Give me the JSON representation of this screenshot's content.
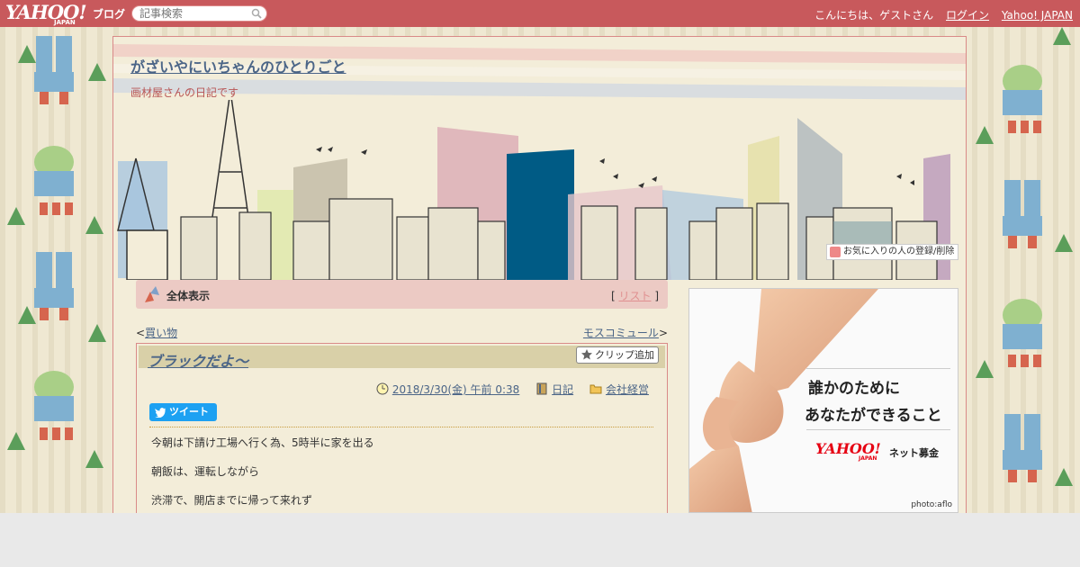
{
  "topbar": {
    "logo_text": "YAHOO!",
    "logo_sub": "JAPAN",
    "service": "ブログ",
    "search_placeholder": "記事検索",
    "greeting": "こんにちは、ゲストさん",
    "login": "ログイン",
    "yahoo_japan": "Yahoo! JAPAN"
  },
  "blog": {
    "title": "がざいやにいちゃんのひとりごと",
    "subtitle": "画材屋さんの日記です",
    "favorite_label": "お気に入りの人の登録/削除"
  },
  "category_bar": {
    "label": "全体表示",
    "list_open": "[",
    "list_link": "リスト",
    "list_close": "]"
  },
  "nav": {
    "prev_mark": "<",
    "prev": "買い物",
    "next": "モスコミュール",
    "next_mark": ">"
  },
  "article": {
    "title": "ブラックだよ～",
    "clip_label": "クリップ追加",
    "date": "2018/3/30(金) 午前 0:38",
    "category1": "日記",
    "category2": "会社経営",
    "tweet_label": "ツイート",
    "paragraphs": [
      "今朝は下請け工場へ行く為、5時半に家を出る",
      "朝飯は、運転しながら",
      "渋滞で、開店までに帰って来れず"
    ]
  },
  "ad": {
    "line1": "誰かのために",
    "line2": "あなたができること",
    "logo": "YAHOO!",
    "logo_sub": "JAPAN",
    "service": "ネット募金",
    "credit": "photo:aflo"
  },
  "colors": {
    "topbar": "#c8595c",
    "link": "#4b6587",
    "frame_border": "#d98a88",
    "category_bar": "#eccac4",
    "tweet": "#1da1f2"
  }
}
